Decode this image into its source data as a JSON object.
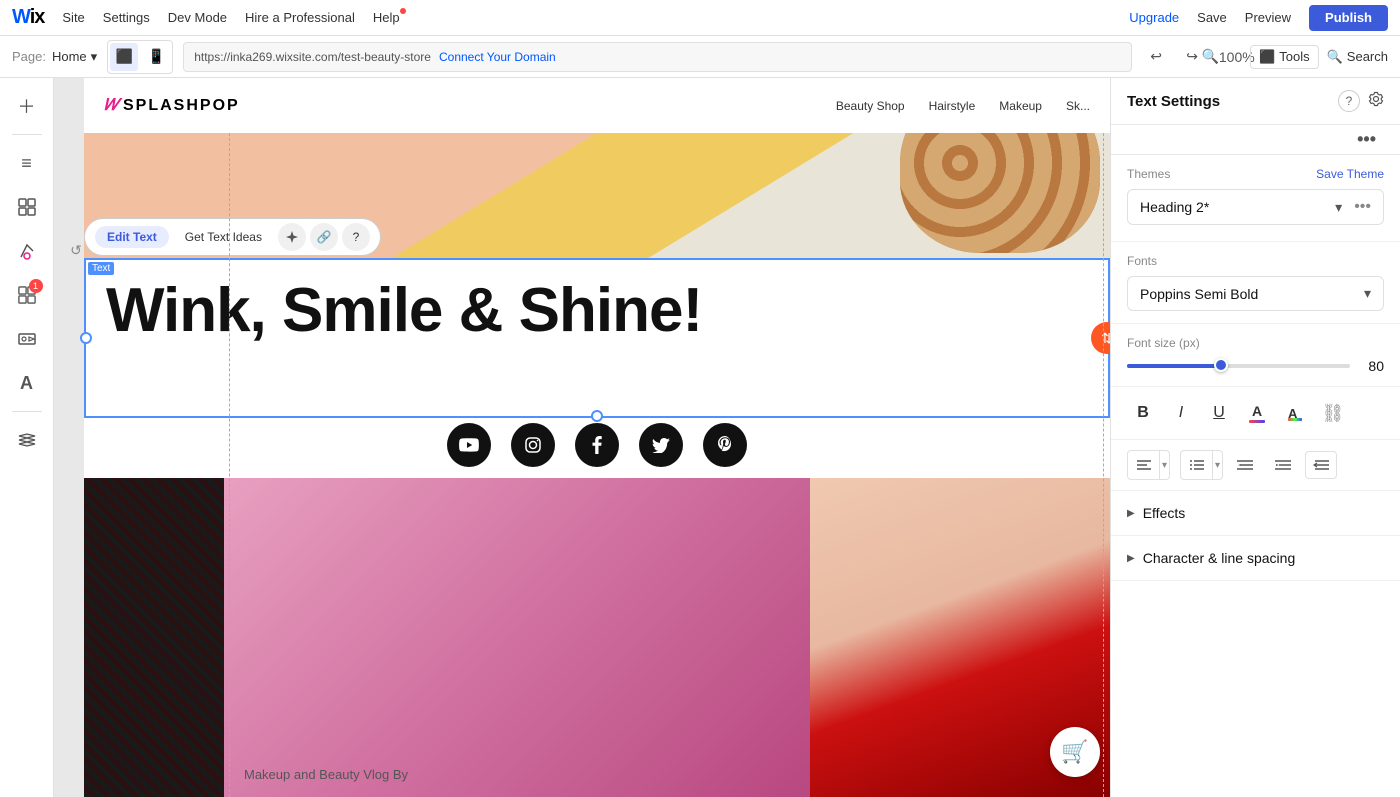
{
  "topnav": {
    "logo": "WiX",
    "nav_items": [
      "Site",
      "Settings",
      "Dev Mode",
      "Hire a Professional",
      "Help"
    ],
    "upgrade_label": "Upgrade",
    "save_label": "Save",
    "preview_label": "Preview",
    "publish_label": "Publish"
  },
  "secondbar": {
    "page_label": "Page:",
    "page_name": "Home",
    "url": "https://inka269.wixsite.com/test-beauty-store",
    "connect_domain": "Connect Your Domain",
    "zoom_label": "100%",
    "tools_label": "Tools",
    "search_label": "Search"
  },
  "canvas": {
    "heading_text": "Wink, Smile & Shine!",
    "subtext": "Makeup and Beauty Vlog By",
    "logo_text": "SPLASHPOP",
    "nav_links": [
      "Beauty Shop",
      "Hairstyle",
      "Makeup",
      "Sk..."
    ]
  },
  "text_toolbar": {
    "edit_text": "Edit Text",
    "get_ideas": "Get Text Ideas",
    "text_label": "Text"
  },
  "right_panel": {
    "title": "Text Settings",
    "themes_label": "Themes",
    "save_theme": "Save Theme",
    "heading_name": "Heading 2*",
    "fonts_label": "Fonts",
    "font_name": "Poppins Semi Bold",
    "fontsize_label": "Font size (px)",
    "fontsize_value": "80",
    "effects_label": "Effects",
    "char_spacing_label": "Character & line spacing"
  },
  "sidebar": {
    "items": [
      {
        "icon": "+",
        "name": "add-element",
        "badge": null
      },
      {
        "icon": "≡",
        "name": "pages",
        "badge": null
      },
      {
        "icon": "□",
        "name": "components",
        "badge": null
      },
      {
        "icon": "✏",
        "name": "design",
        "badge": null
      },
      {
        "icon": "❖",
        "name": "apps",
        "badge": "1"
      },
      {
        "icon": "≋",
        "name": "media",
        "badge": null
      },
      {
        "icon": "A",
        "name": "text",
        "badge": null
      }
    ]
  },
  "social_icons": [
    "▶",
    "◉",
    "f",
    "𝕏",
    "⊕"
  ],
  "colors": {
    "accent_blue": "#3B5BDB",
    "orange": "#ff5722",
    "pink": "#e91e8c",
    "selection_blue": "#4d90fe"
  }
}
